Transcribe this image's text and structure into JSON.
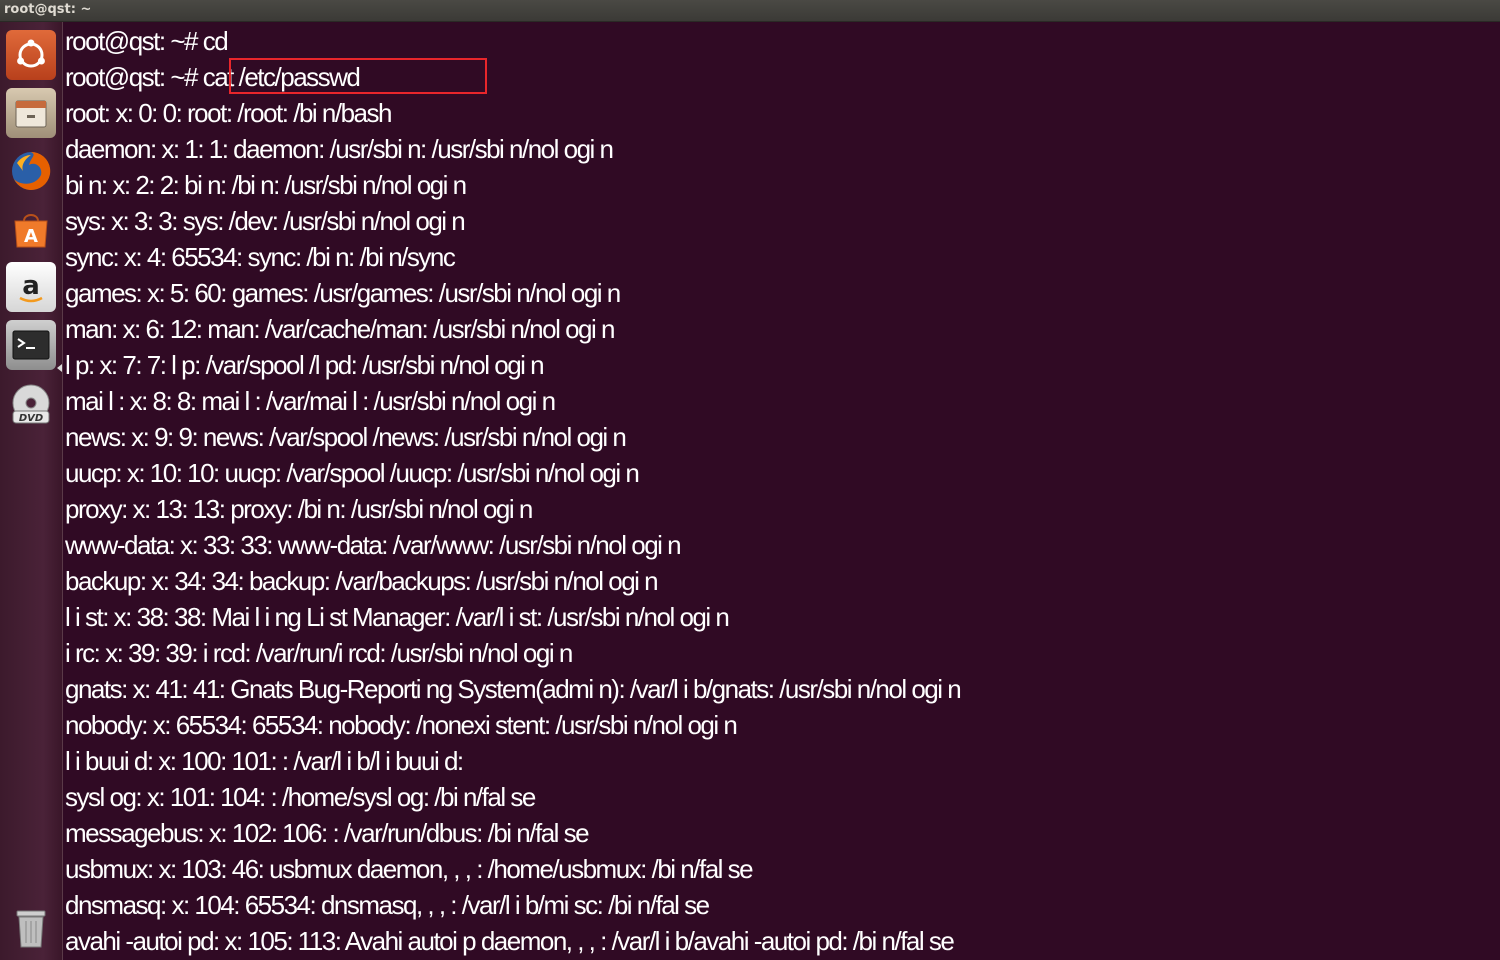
{
  "window": {
    "title": "root@qst: ~"
  },
  "launcher": {
    "items": [
      {
        "name": "dash-icon",
        "color": "#e05a2a"
      },
      {
        "name": "files-icon",
        "color": "#c9b79c"
      },
      {
        "name": "firefox-icon",
        "color": "#e66000"
      },
      {
        "name": "software-center-icon",
        "color": "#f07a2a"
      },
      {
        "name": "amazon-icon",
        "color": "#ffffff"
      },
      {
        "name": "terminal-icon",
        "color": "#2d2d2d"
      },
      {
        "name": "dvd-icon",
        "color": "#d9d9d9"
      },
      {
        "name": "trash-icon",
        "color": "#bfbfbf"
      }
    ]
  },
  "terminal": {
    "lines": [
      "root@qst: ~# cd",
      "root@qst: ~# cat /etc/passwd",
      "root: x: 0: 0: root: /root: /bi n/bash",
      "daemon: x: 1: 1: daemon: /usr/sbi n: /usr/sbi n/nol ogi n",
      "bi n: x: 2: 2: bi n: /bi n: /usr/sbi n/nol ogi n",
      "sys: x: 3: 3: sys: /dev: /usr/sbi n/nol ogi n",
      "sync: x: 4: 65534: sync: /bi n: /bi n/sync",
      "games: x: 5: 60: games: /usr/games: /usr/sbi n/nol ogi n",
      "man: x: 6: 12: man: /var/cache/man: /usr/sbi n/nol ogi n",
      "l p: x: 7: 7: l p: /var/spool /l pd: /usr/sbi n/nol ogi n",
      "mai l : x: 8: 8: mai l : /var/mai l : /usr/sbi n/nol ogi n",
      "news: x: 9: 9: news: /var/spool /news: /usr/sbi n/nol ogi n",
      "uucp: x: 10: 10: uucp: /var/spool /uucp: /usr/sbi n/nol ogi n",
      "proxy: x: 13: 13: proxy: /bi n: /usr/sbi n/nol ogi n",
      "www-data: x: 33: 33: www-data: /var/www: /usr/sbi n/nol ogi n",
      "backup: x: 34: 34: backup: /var/backups: /usr/sbi n/nol ogi n",
      "l i st: x: 38: 38: Mai l i ng Li st Manager: /var/l i st: /usr/sbi n/nol ogi n",
      "i rc: x: 39: 39: i rcd: /var/run/i rcd: /usr/sbi n/nol ogi n",
      "gnats: x: 41: 41: Gnats Bug-Reporti ng System(admi n): /var/l i b/gnats: /usr/sbi n/nol ogi n",
      "nobody: x: 65534: 65534: nobody: /nonexi stent: /usr/sbi n/nol ogi n",
      "l i buui d: x: 100: 101: : /var/l i b/l i buui d:",
      "sysl og: x: 101: 104: : /home/sysl og: /bi n/fal se",
      "messagebus: x: 102: 106: : /var/run/dbus: /bi n/fal se",
      "usbmux: x: 103: 46: usbmux daemon, , , : /home/usbmux: /bi n/fal se",
      "dnsmasq: x: 104: 65534: dnsmasq, , , : /var/l i b/mi sc: /bi n/fal se",
      "avahi -autoi pd: x: 105: 113: Avahi autoi p daemon, , , : /var/l i b/avahi -autoi pd: /bi n/fal se"
    ],
    "highlight_color": "#e8262b",
    "background": "#300a24"
  }
}
